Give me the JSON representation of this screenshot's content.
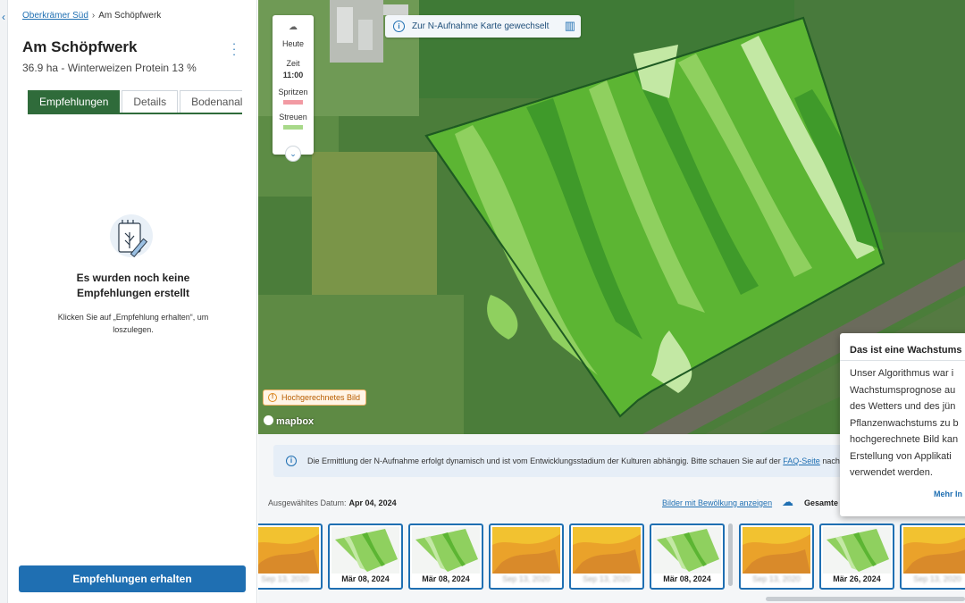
{
  "breadcrumb": {
    "parent": "Oberkrämer Süd",
    "current": "Am Schöpfwerk"
  },
  "field": {
    "title": "Am Schöpfwerk",
    "subtitle": "36.9 ha - Winterweizen Protein 13 %"
  },
  "tabs": [
    {
      "label": "Empfehlungen",
      "active": true
    },
    {
      "label": "Details",
      "active": false
    },
    {
      "label": "Bodenanalyse",
      "active": false
    }
  ],
  "empty_state": {
    "title_line1": "Es wurden noch keine",
    "title_line2": "Empfehlungen erstellt",
    "desc_line1": "Klicken Sie auf „Empfehlung erhalten“, um",
    "desc_line2": "loszulegen."
  },
  "primary_button": "Empfehlungen erhalten",
  "map": {
    "banner": "Zur N-Aufnahme Karte gewechselt",
    "legend": {
      "today": "Heute",
      "zeit": "Zeit",
      "time": "11:00",
      "spray": "Spritzen",
      "spread": "Streuen",
      "spray_color": "#f29aa3",
      "spread_color": "#a8d98a"
    },
    "forecast_badge": "Hochgerechnetes Bild",
    "attribution": "mapbox",
    "colors": {
      "dark": "#3f9a2a",
      "mid": "#5cb533",
      "light": "#8fd05f",
      "pale": "#c3e8a4",
      "outline": "#1e5a22"
    }
  },
  "notice": {
    "text_before": "Die Ermittlung der N-Aufnahme erfolgt dynamisch und ist vom Entwicklungsstadium der Kulturen abhängig. Bitte schauen Sie auf der",
    "link": "FAQ-Seite",
    "text_after": "nach f"
  },
  "timeline": {
    "selected_label": "Ausgewähltes Datum:",
    "selected_date": "Apr 04, 2024",
    "cloud_link": "Bilder mit Bewölkung anzeigen",
    "total_label": "Gesamte",
    "thumbs": [
      {
        "caption": "Sep 13, 2020",
        "kind": "yellow",
        "blurred": true
      },
      {
        "caption": "Mär 08, 2024",
        "kind": "green",
        "blurred": false
      },
      {
        "caption": "Mär 08, 2024",
        "kind": "green",
        "blurred": false
      },
      {
        "caption": "Sep 13, 2020",
        "kind": "yellow",
        "blurred": true
      },
      {
        "caption": "Sep 13, 2020",
        "kind": "yellow",
        "blurred": true
      },
      {
        "caption": "Mär 08, 2024",
        "kind": "green",
        "blurred": false
      },
      {
        "caption": "Sep 13, 2020",
        "kind": "yellow",
        "blurred": true
      },
      {
        "caption": "Mär 26, 2024",
        "kind": "green",
        "blurred": false
      },
      {
        "caption": "Sep 13, 2020",
        "kind": "yellow",
        "blurred": true
      }
    ]
  },
  "popover": {
    "title": "Das ist eine Wachstums",
    "lines": [
      "Unser Algorithmus war i",
      "Wachstumsprognose au",
      "des Wetters und des jün",
      "Pflanzenwachstums zu b",
      "hochgerechnete Bild kan",
      "Erstellung von Applikati",
      "verwendet werden."
    ],
    "more": "Mehr In"
  }
}
